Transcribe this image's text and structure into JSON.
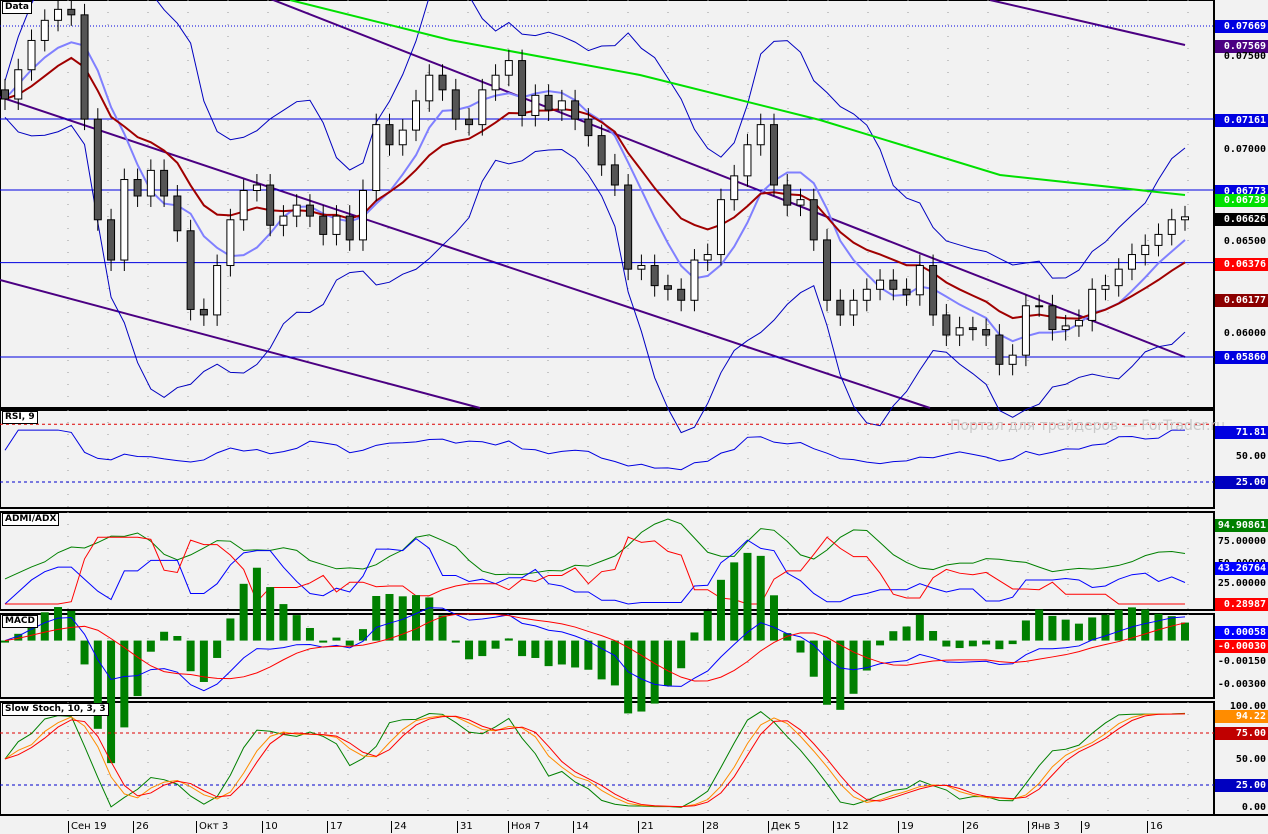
{
  "panels": {
    "price": "Data",
    "rsi": "RSI, 9",
    "adx": "ADMI/ADX",
    "macd": "MACD",
    "stoch": "Slow Stoch, 10, 3, 3"
  },
  "watermark": "Портал для трейдеров — ForTrader.ru",
  "dates": [
    "Сен 19",
    "26",
    "Окт 3",
    "10",
    "17",
    "24",
    "31",
    "Ноя 7",
    "14",
    "21",
    "28",
    "Дек 5",
    "12",
    "19",
    "26",
    "Янв 3",
    "9",
    "16"
  ],
  "price_axis": {
    "ticks": [
      "0.07500",
      "0.07000",
      "0.06500",
      "0.06000"
    ],
    "tags": [
      {
        "text": "0.07669",
        "color": "#0000e0"
      },
      {
        "text": "0.07569",
        "color": "#4b0082"
      },
      {
        "text": "0.07161",
        "color": "#0000e0"
      },
      {
        "text": "0.06773",
        "color": "#0000e0"
      },
      {
        "text": "0.06739",
        "color": "#00e000"
      },
      {
        "text": "0.06626",
        "color": "#000000"
      },
      {
        "text": "0.06376",
        "color": "#ff0000"
      },
      {
        "text": "0.06177",
        "color": "#8b0000"
      },
      {
        "text": "0.05860",
        "color": "#0000e0"
      }
    ]
  },
  "rsi_axis": {
    "tags": [
      {
        "text": "71.81",
        "color": "#0000e0"
      },
      {
        "text": "25.00",
        "color": "#0000c0"
      }
    ],
    "ticks": [
      "50.00"
    ]
  },
  "adx_axis": {
    "tags": [
      {
        "text": "94.90861",
        "color": "#008000"
      },
      {
        "text": "43.26764",
        "color": "#0000ff"
      },
      {
        "text": "0.28987",
        "color": "#ff0000"
      }
    ],
    "ticks": [
      "75.00000",
      "50.00000",
      "25.00000"
    ]
  },
  "macd_axis": {
    "tags": [
      {
        "text": "0.00058",
        "color": "#0000ff"
      },
      {
        "text": "-0.00030",
        "color": "#ff0000"
      }
    ],
    "ticks": [
      "-0.00150",
      "-0.00300"
    ]
  },
  "stoch_axis": {
    "tags": [
      {
        "text": "94.22",
        "color": "#ff8c00"
      },
      {
        "text": "75.00",
        "color": "#c00000"
      },
      {
        "text": "25.00",
        "color": "#0000c0"
      }
    ],
    "ticks": [
      "100.00",
      "50.00",
      "0.00"
    ]
  },
  "chart_data": {
    "type": "candlestick",
    "title": "Data",
    "levels": [
      0.07669,
      0.07161,
      0.06773,
      0.06376,
      0.0586
    ],
    "ylim": [
      0.0558,
      0.0781
    ],
    "closes": [
      0.0727,
      0.0743,
      0.0759,
      0.077,
      0.0776,
      0.0773,
      0.0716,
      0.0661,
      0.0639,
      0.0683,
      0.0674,
      0.0688,
      0.0674,
      0.0655,
      0.0612,
      0.0609,
      0.0636,
      0.0661,
      0.0677,
      0.068,
      0.0658,
      0.0663,
      0.0669,
      0.0663,
      0.0653,
      0.0663,
      0.065,
      0.0677,
      0.0713,
      0.0702,
      0.071,
      0.0726,
      0.074,
      0.0732,
      0.0716,
      0.0713,
      0.0732,
      0.074,
      0.0748,
      0.0718,
      0.0729,
      0.0721,
      0.0726,
      0.0716,
      0.0707,
      0.0691,
      0.068,
      0.0634,
      0.0636,
      0.0625,
      0.0623,
      0.0617,
      0.0639,
      0.0642,
      0.0672,
      0.0685,
      0.0702,
      0.0713,
      0.068,
      0.0669,
      0.0672,
      0.065,
      0.0617,
      0.0609,
      0.0617,
      0.0623,
      0.0628,
      0.0623,
      0.062,
      0.0636,
      0.0609,
      0.0598,
      0.0602,
      0.0601,
      0.0598,
      0.0582,
      0.0587,
      0.0614,
      0.0614,
      0.0601,
      0.0603,
      0.0606,
      0.0623,
      0.0625,
      0.0634,
      0.0642,
      0.0647,
      0.0653,
      0.0661,
      0.06626
    ],
    "indicators": {
      "rsi_period": 9,
      "rsi_levels": [
        75,
        25
      ],
      "stoch": [
        10,
        3,
        3
      ],
      "stoch_levels": [
        75,
        25
      ],
      "rsi_last": 71.81,
      "adx_last": [
        94.90861,
        43.26764,
        0.28987
      ],
      "macd_last": [
        0.00058,
        -0.0003
      ],
      "stoch_last": 94.22
    }
  }
}
